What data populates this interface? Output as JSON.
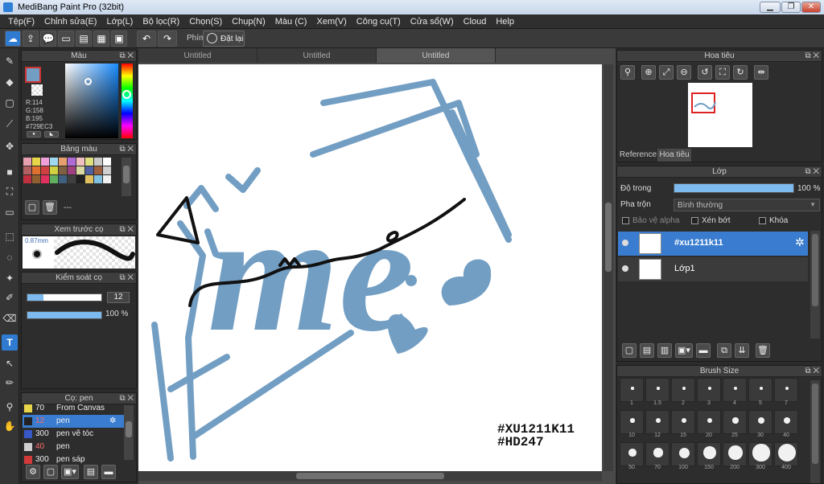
{
  "window": {
    "title": "MediBang Paint Pro (32bit)"
  },
  "menu": [
    "Tệp(F)",
    "Chỉnh sửa(E)",
    "Lớp(L)",
    "Bộ lọc(R)",
    "Chọn(S)",
    "Chụp(N)",
    "Màu (C)",
    "Xem(V)",
    "Công cụ(T)",
    "Cửa sổ(W)",
    "Cloud",
    "Help"
  ],
  "toolbar": {
    "shortcut_label": "Phím",
    "reset_label": "Đặt lại"
  },
  "color_panel": {
    "title": "Màu",
    "r": "R:114",
    "g": "G:158",
    "b": "B:195",
    "hex": "#729EC3",
    "current_color": "#729EC3"
  },
  "palette_panel": {
    "title": "Bảng màu",
    "extra": "---"
  },
  "brush_preview_panel": {
    "title": "Xem trước cọ",
    "size": "0.87mm"
  },
  "brush_control_panel": {
    "title": "Kiểm soát cọ",
    "size_value": "12",
    "opacity_value": "100 %"
  },
  "brush_panel": {
    "title": "Cọ: pen",
    "items": [
      {
        "num": "70",
        "name": "From Canvas",
        "color": "#e8d64a"
      },
      {
        "num": "12",
        "name": "pen",
        "color": "#222222"
      },
      {
        "num": "300",
        "name": "pen vẽ tóc",
        "color": "#3858c8"
      },
      {
        "num": "40",
        "name": "pen",
        "color": "#cfcfcf"
      },
      {
        "num": "300",
        "name": "pen sáp",
        "color": "#d23a3a"
      }
    ]
  },
  "canvas_tabs": [
    "Untitled",
    "Untitled",
    "Untitled"
  ],
  "canvas": {
    "watermark_line1": "#XU1211K11",
    "watermark_line2": "#HD247",
    "art_text": "me",
    "art_color": "#729EC3"
  },
  "navigator_panel": {
    "title": "Hoa tiêu",
    "tab_reference": "Reference",
    "tab_navigator": "Hoa tiêu"
  },
  "layer_panel": {
    "title": "Lớp",
    "opacity_label": "Độ trong",
    "opacity_value": "100 %",
    "opacity_fraction": 1.0,
    "blend_label": "Pha trộn",
    "blend_value": "Bình thường",
    "protect_alpha": "Bảo vệ alpha",
    "clipping": "Xén bớt",
    "lock": "Khóa",
    "layers": [
      {
        "name": "#xu1211k11",
        "selected": true
      },
      {
        "name": "Lớp1",
        "selected": false
      }
    ]
  },
  "brush_size_panel": {
    "title": "Brush Size",
    "sizes": [
      "1",
      "1.5",
      "2",
      "3",
      "4",
      "5",
      "7",
      "10",
      "12",
      "15",
      "20",
      "25",
      "30",
      "40",
      "50",
      "70",
      "100",
      "150",
      "200",
      "300",
      "400"
    ]
  }
}
